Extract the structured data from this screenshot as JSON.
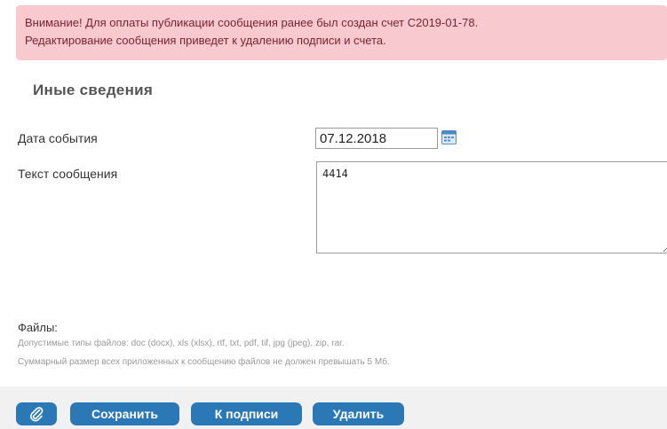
{
  "alert": {
    "line1": "Внимание! Для оплаты публикации сообщения ранее был создан счет С2019-01-78.",
    "line2": "Редактирование сообщения приведет к удалению подписи и счета."
  },
  "section": {
    "title": "Иные сведения"
  },
  "form": {
    "event_date_label": "Дата события",
    "event_date_value": "07.12.2018",
    "message_label": "Текст сообщения",
    "message_value": "4414"
  },
  "files": {
    "title": "Файлы:",
    "allowed_types": "Допустимые типы файлов: doc (docx), xls (xlsx), rtf, txt, pdf, tif, jpg (jpeg), zip, rar.",
    "size_limit": "Суммарный размер всех приложенных к сообщению файлов не должен превышать 5 Мб."
  },
  "actions": {
    "attach_icon": "paperclip-icon",
    "save_label": "Сохранить",
    "sign_label": "К подписи",
    "delete_label": "Удалить"
  },
  "colors": {
    "alert_bg": "#f8c9cf",
    "button_bg": "#2b78b7"
  }
}
